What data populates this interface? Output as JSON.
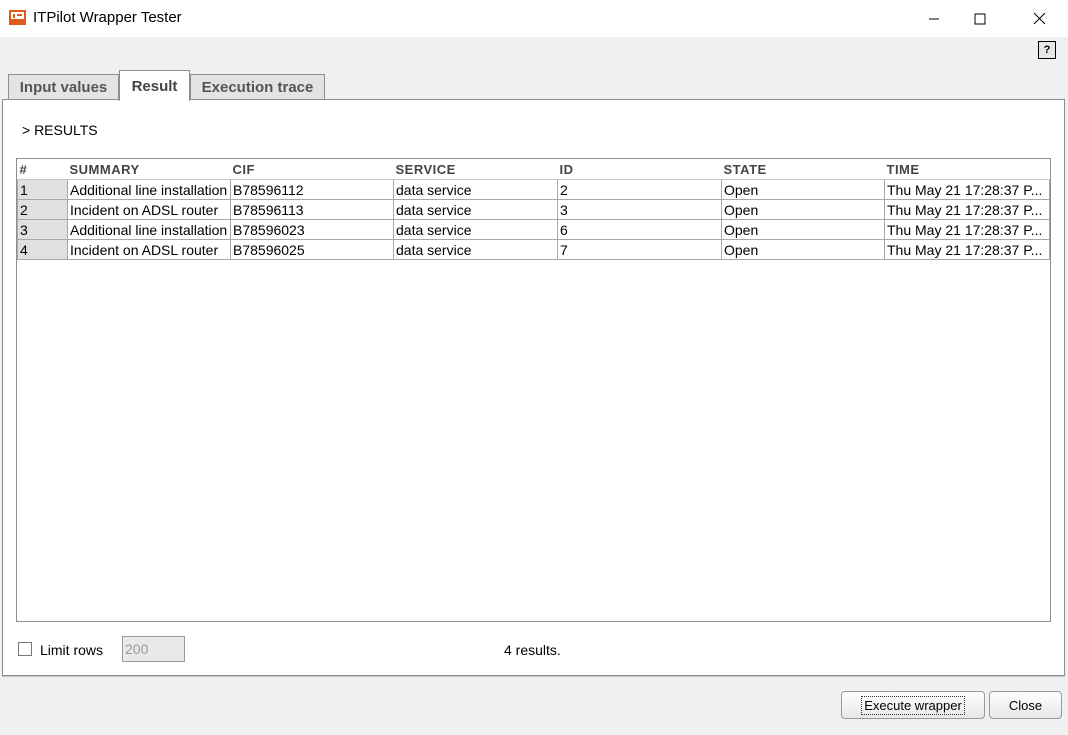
{
  "window": {
    "title": "ITPilot Wrapper Tester",
    "icon": "itpilot-logo-icon",
    "controls": [
      "minimize-icon",
      "maximize-icon",
      "close-icon"
    ]
  },
  "help": {
    "label": "?"
  },
  "tabs": [
    {
      "label": "Input values",
      "active": false
    },
    {
      "label": "Result",
      "active": true
    },
    {
      "label": "Execution trace",
      "active": false
    }
  ],
  "results": {
    "heading": "> RESULTS",
    "columns": [
      "#",
      "SUMMARY",
      "CIF",
      "SERVICE",
      "ID",
      "STATE",
      "TIME"
    ],
    "rows": [
      [
        "1",
        "Additional line installation",
        "B78596112",
        "data service",
        "2",
        "Open",
        "Thu May 21 17:28:37 P..."
      ],
      [
        "2",
        "Incident on ADSL router",
        "B78596113",
        "data service",
        "3",
        "Open",
        "Thu May 21 17:28:37 P..."
      ],
      [
        "3",
        "Additional line installation",
        "B78596023",
        "data service",
        "6",
        "Open",
        "Thu May 21 17:28:37 P..."
      ],
      [
        "4",
        "Incident on ADSL router",
        "B78596025",
        "data service",
        "7",
        "Open",
        "Thu May 21 17:28:37 P..."
      ]
    ]
  },
  "footer": {
    "limit_label": "Limit rows",
    "limit_checked": false,
    "limit_value": "200",
    "count_text": "4 results.",
    "execute_label": "Execute wrapper",
    "close_label": "Close"
  },
  "colors": {
    "accent": "#e05a1a",
    "panel": "#ffffff",
    "background": "#f0f0f0"
  }
}
